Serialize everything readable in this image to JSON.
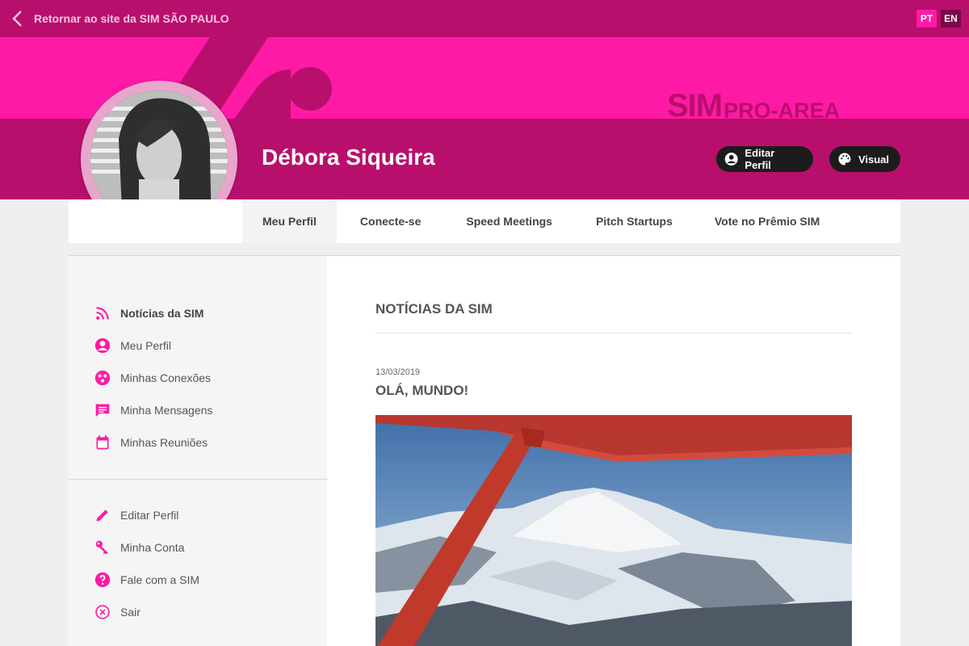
{
  "topbar": {
    "back_label": "Retornar ao site da SIM SÃO PAULO",
    "languages": [
      "PT",
      "EN"
    ],
    "active_language": "PT"
  },
  "brand": {
    "name": "SIM",
    "suffix": "PRO-AREA"
  },
  "profile": {
    "name": "Débora Siqueira",
    "edit_button": "Editar Perfil",
    "visual_button": "Visual"
  },
  "tabs": [
    {
      "label": "Meu Perfil",
      "active": true
    },
    {
      "label": "Conecte-se"
    },
    {
      "label": "Speed Meetings"
    },
    {
      "label": "Pitch Startups"
    },
    {
      "label": "Vote no Prêmio SIM"
    }
  ],
  "sidebar": {
    "primary": [
      {
        "label": "Notícias da SIM",
        "icon": "rss-icon",
        "active": true
      },
      {
        "label": "Meu Perfil",
        "icon": "account-circle-icon"
      },
      {
        "label": "Minhas Conexões",
        "icon": "connections-icon"
      },
      {
        "label": "Minha Mensagens",
        "icon": "message-icon"
      },
      {
        "label": "Minhas Reuniões",
        "icon": "calendar-icon"
      }
    ],
    "secondary": [
      {
        "label": "Editar Perfil",
        "icon": "pencil-icon"
      },
      {
        "label": "Minha Conta",
        "icon": "key-icon"
      },
      {
        "label": "Fale com a SIM",
        "icon": "help-icon"
      },
      {
        "label": "Sair",
        "icon": "close-circle-icon"
      }
    ]
  },
  "main": {
    "section_title": "NOTÍCIAS DA SIM",
    "post": {
      "date": "13/03/2019",
      "title": "OLÁ, MUNDO!"
    }
  },
  "colors": {
    "magenta": "#ff1aa6",
    "dark_magenta": "#b90f6c",
    "pill_bg": "#1c1c1c"
  }
}
